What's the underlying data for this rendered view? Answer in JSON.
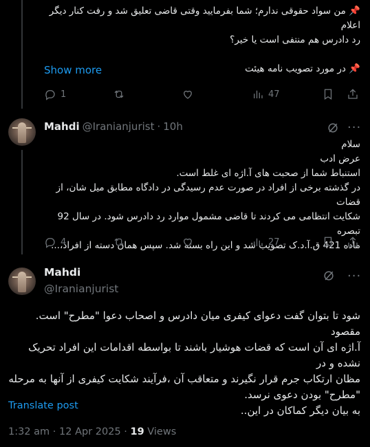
{
  "tweet1": {
    "lines": [
      "📌 من سواد حقوقی ندارم؛ شما بفرمایید وقتی قاضی تعلیق شد و رفت کنار دیگر اعلام",
      "رد دادرس هم منتفی است یا خیر؟",
      "",
      "📌 در مورد تصویب نامه هیئت"
    ],
    "show_more": "Show more",
    "actions": {
      "replies": "1",
      "reposts": "",
      "likes": "",
      "views": "47"
    }
  },
  "tweet2": {
    "name": "Mahdi",
    "handle": "@Iranianjurist",
    "dot": "·",
    "time": "10h",
    "more": "···",
    "lines": [
      "سلام",
      "عرض ادب",
      "استنباط شما از صحبت های آ.اژه ای غلط است.",
      "در گذشته برخی از افراد در صورت عدم رسیدگی در دادگاه مطابق میل شان، از قضات",
      "شکایت انتظامی می کردند تا قاضی مشمول موارد رد دادرس شود. در سال 92 تبصره",
      "ماده 421 ق.آ.د.ک تصویب شد و این راه بسته شد. سپس همان دسته از افراد،..."
    ],
    "actions": {
      "replies": "4",
      "reposts": "",
      "likes": "",
      "views": "27"
    }
  },
  "tweet3": {
    "name": "Mahdi",
    "handle": "@Iranianjurist",
    "lines": [
      "شود تا بتوان گفت دعوای کیفری میان دادرس و اصحاب دعوا \"مطرح\" است. مقصود",
      "آ.اژه ای آن است که قضات هوشیار باشند تا بواسطه اقدامات این افراد تحریک نشده و در",
      "مظان ارتکاب جرم قرار نگیرند و متعاقب آن ،فرآیند شکایت کیفری از آنها به مرحله",
      "\"مطرح\" بودن دعوی نرسد.",
      "به بیان دیگر کماکان در این.."
    ],
    "translate": "Translate post",
    "time": "1:32 am",
    "dot": "·",
    "date": "12 Apr 2025",
    "views_count": "19",
    "views_label": "Views"
  }
}
